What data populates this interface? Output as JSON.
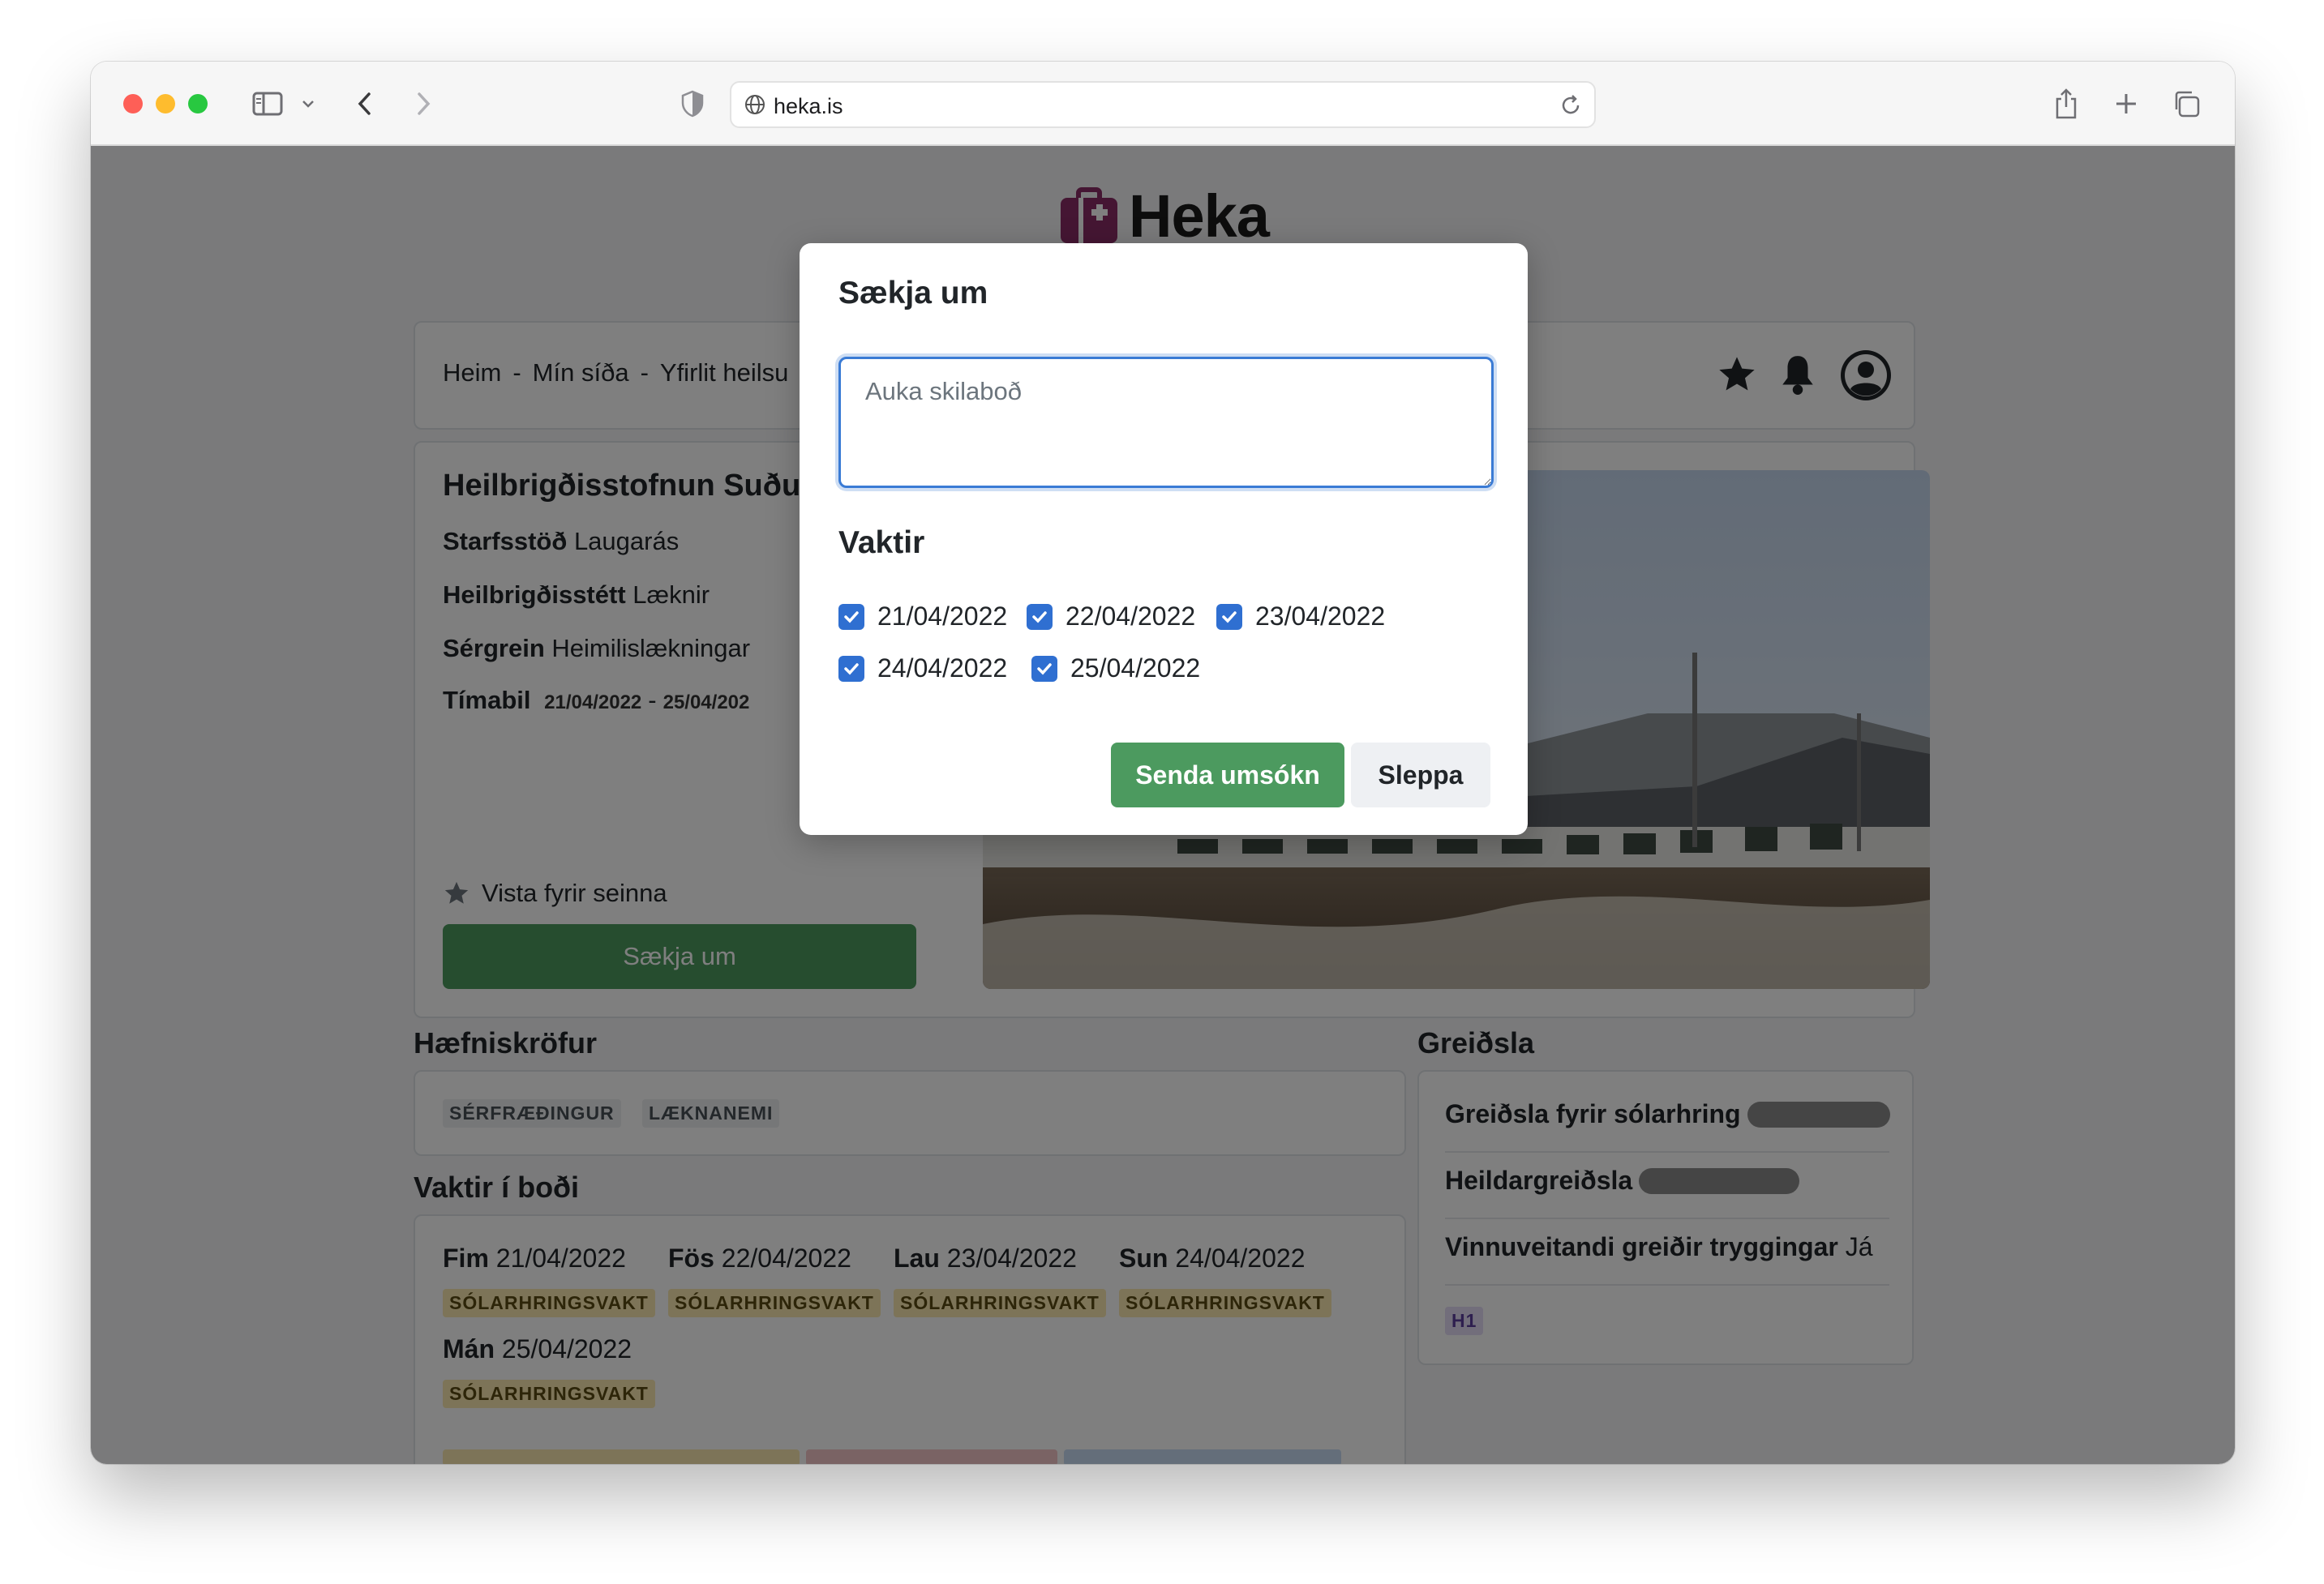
{
  "browser": {
    "url": "heka.is"
  },
  "brand": {
    "name": "Heka",
    "accent": "#8a2c67"
  },
  "breadcrumb": {
    "items": [
      "Heim",
      "Mín síða",
      "Yfirlit heilsu"
    ]
  },
  "listing": {
    "title": "Heilbrigðisstofnun Suðu",
    "station_label": "Starfsstöð",
    "station_value": "Laugarás",
    "profession_label": "Heilbrigðisstétt",
    "profession_value": "Læknir",
    "specialty_label": "Sérgrein",
    "specialty_value": "Heimilislækningar",
    "period_label": "Tímabil",
    "period_from": "21/04/2022",
    "period_sep": "-",
    "period_to": "25/04/202",
    "save_label": "Vista fyrir seinna",
    "apply_label": "Sækja um"
  },
  "qualifications": {
    "heading": "Hæfniskröfur",
    "tags": [
      "SÉRFRÆÐINGUR",
      "LÆKNANEMI"
    ]
  },
  "shifts": {
    "heading": "Vaktir í boði",
    "items": [
      {
        "day": "Fim",
        "date": "21/04/2022",
        "type": "SÓLARHRINGSVAKT"
      },
      {
        "day": "Fös",
        "date": "22/04/2022",
        "type": "SÓLARHRINGSVAKT"
      },
      {
        "day": "Lau",
        "date": "23/04/2022",
        "type": "SÓLARHRINGSVAKT"
      },
      {
        "day": "Sun",
        "date": "24/04/2022",
        "type": "SÓLARHRINGSVAKT"
      },
      {
        "day": "Mán",
        "date": "25/04/2022",
        "type": "SÓLARHRINGSVAKT"
      }
    ]
  },
  "payment": {
    "heading": "Greiðsla",
    "per_day_label": "Greiðsla fyrir sólarhring",
    "total_label": "Heildargreiðsla",
    "insurance_label": "Vinnuveitandi greiðir tryggingar",
    "insurance_value": "Já",
    "tag": "H1"
  },
  "modal": {
    "title": "Sækja um",
    "message_placeholder": "Auka skilaboð",
    "shifts_heading": "Vaktir",
    "dates": [
      "21/04/2022",
      "22/04/2022",
      "23/04/2022",
      "24/04/2022",
      "25/04/2022"
    ],
    "submit_label": "Senda umsókn",
    "cancel_label": "Sleppa"
  }
}
